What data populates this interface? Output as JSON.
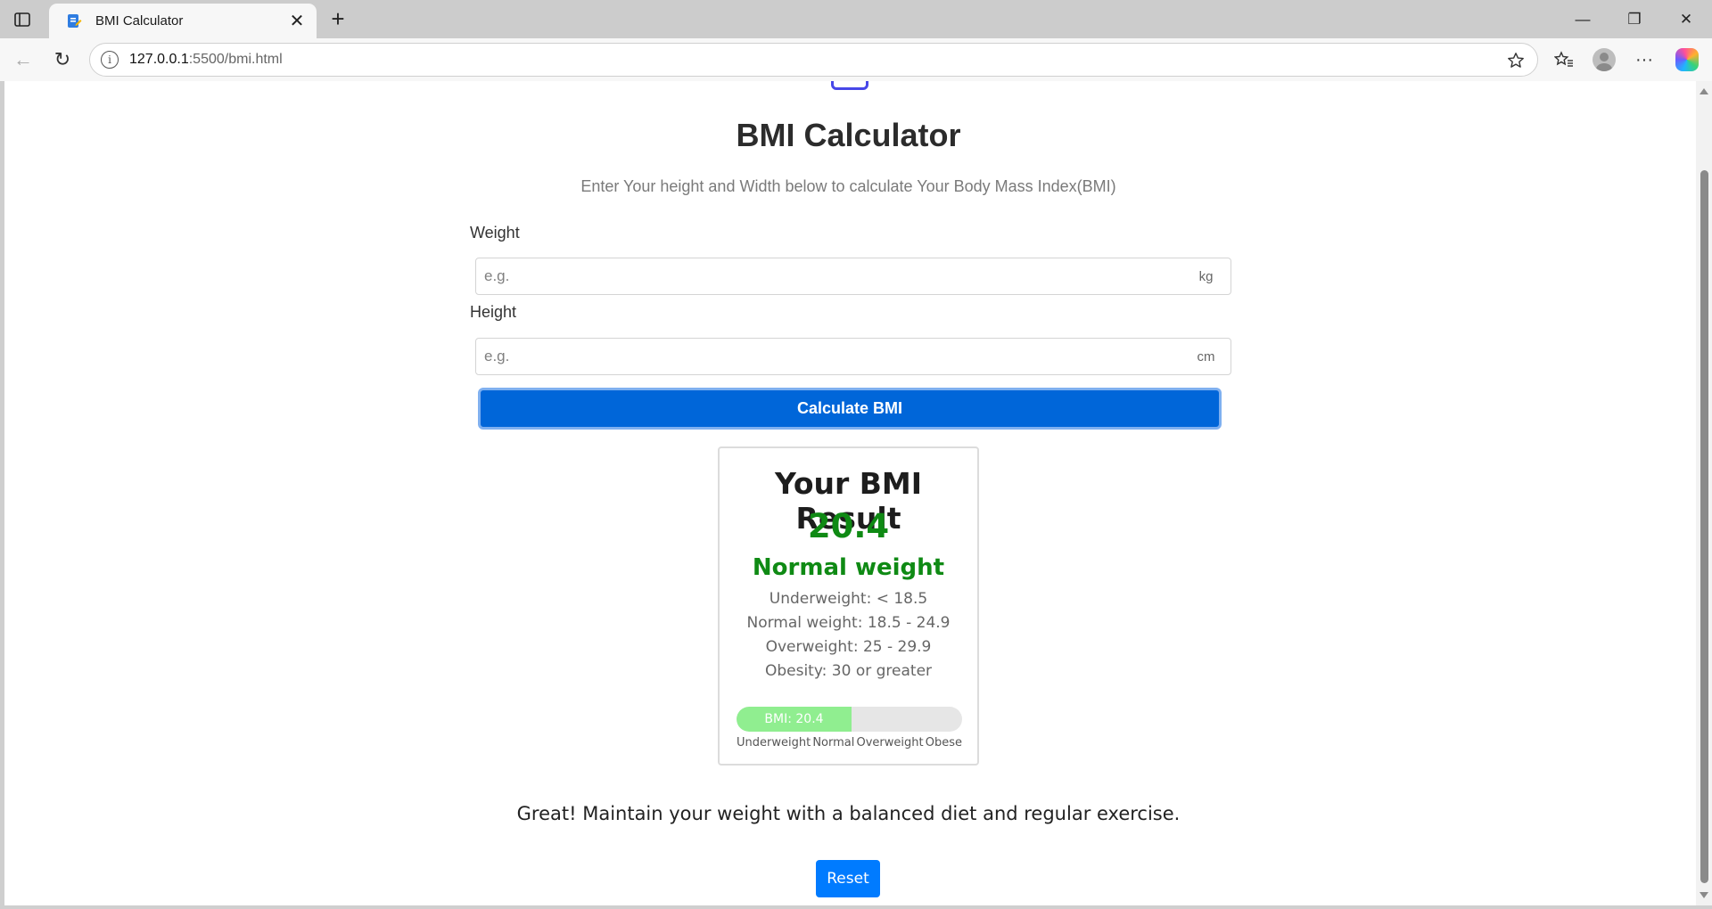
{
  "browser": {
    "tab_title": "BMI Calculator",
    "url_host": "127.0.0.1",
    "url_path": ":5500/bmi.html"
  },
  "page": {
    "title": "BMI Calculator",
    "subtitle": "Enter Your height and Width below to calculate Your Body Mass Index(BMI)",
    "weight": {
      "label": "Weight",
      "placeholder": "e.g.",
      "value": "",
      "unit": "kg"
    },
    "height": {
      "label": "Height",
      "placeholder": "e.g.",
      "value": "",
      "unit": "cm"
    },
    "calculate_label": "Calculate BMI",
    "result": {
      "heading": "Your BMI Result",
      "value": "20.4",
      "category": "Normal weight",
      "ranges": [
        "Underweight: < 18.5",
        "Normal weight: 18.5 - 24.9",
        "Overweight: 25 - 29.9",
        "Obesity: 30 or greater"
      ],
      "bar_label": "BMI: 20.4",
      "bar_fraction": 0.51,
      "scale": [
        "Underweight",
        "Normal",
        "Overweight",
        "Obese"
      ]
    },
    "advice": "Great! Maintain your weight with a balanced diet and regular exercise.",
    "reset_label": "Reset"
  },
  "colors": {
    "accent": "#0066d9",
    "result_green": "#0f8a14",
    "bar_fill": "#90ee90",
    "reset": "#007bff"
  }
}
